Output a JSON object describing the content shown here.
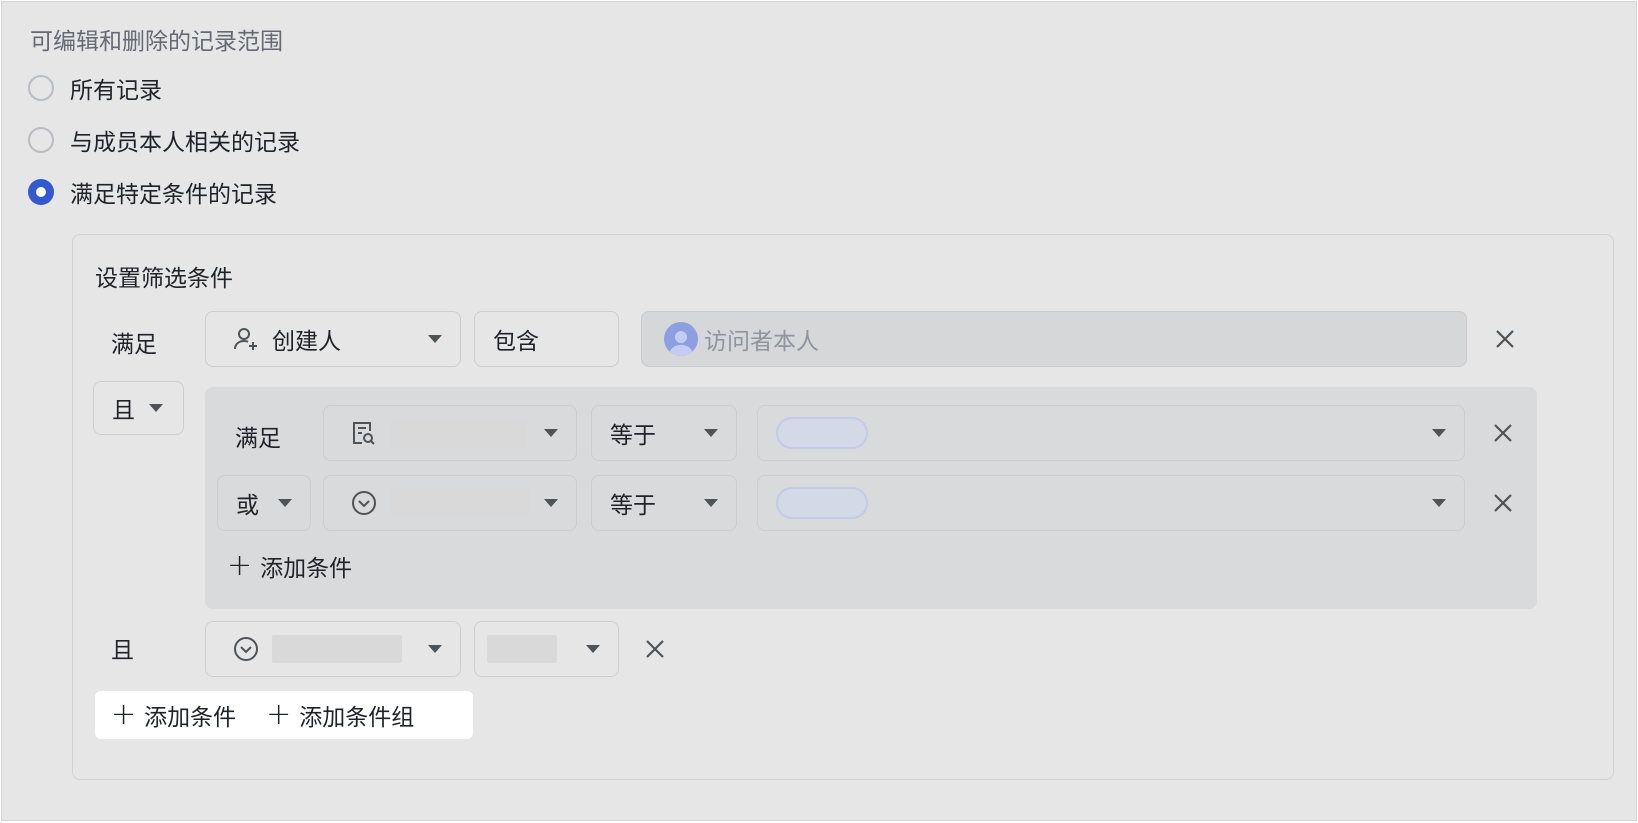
{
  "section_title": "可编辑和删除的记录范围",
  "scope_options": [
    {
      "label": "所有记录",
      "checked": false
    },
    {
      "label": "与成员本人相关的记录",
      "checked": false
    },
    {
      "label": "满足特定条件的记录",
      "checked": true
    }
  ],
  "filter": {
    "title": "设置筛选条件",
    "row1": {
      "prefix": "满足",
      "field": "创建人",
      "operator": "包含",
      "value": "访问者本人"
    },
    "conjunction": "且",
    "group": {
      "row1_prefix": "满足",
      "row1_operator": "等于",
      "row2_conjunction": "或",
      "row2_operator": "等于",
      "add_condition": "添加条件"
    },
    "row3": {
      "prefix": "且"
    },
    "add_condition": "添加条件",
    "add_group": "添加条件组"
  },
  "colors": {
    "accent": "#3359d1",
    "background": "#e6e6e6",
    "group_background": "#d9dadb"
  },
  "icons": {
    "person_add": "person-add-icon",
    "record_search": "record-search-icon",
    "circle_chevron": "circle-chevron-down-icon",
    "close": "close-icon",
    "dropdown": "caret-down-icon",
    "plus": "plus-icon"
  }
}
